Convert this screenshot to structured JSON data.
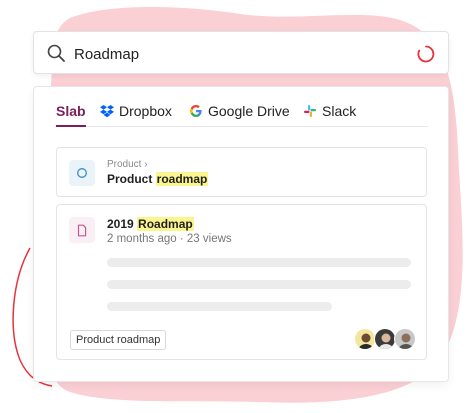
{
  "search": {
    "query": "Roadmap",
    "icon": "search-icon",
    "loading_icon": "spinner-icon"
  },
  "tabs": [
    {
      "label": "Slab",
      "icon": "",
      "active": true
    },
    {
      "label": "Dropbox",
      "icon": "dropbox-icon",
      "active": false
    },
    {
      "label": "Google Drive",
      "icon": "google-icon",
      "active": false
    },
    {
      "label": "Slack",
      "icon": "slack-icon",
      "active": false
    }
  ],
  "results": [
    {
      "breadcrumb": "Product",
      "title_prefix": "Product ",
      "title_highlight": "roadmap",
      "icon": "topic-icon"
    },
    {
      "title_prefix": "2019 ",
      "title_highlight": "Roadmap",
      "meta": "2 months ago · 23 views",
      "tag": "Product roadmap",
      "icon": "document-icon",
      "avatars": [
        "avatar-1",
        "avatar-2",
        "avatar-3"
      ]
    }
  ],
  "colors": {
    "accent": "#7a1f5c",
    "highlight": "#faf58e",
    "blob": "#fbd0d5",
    "spinner": "#e8323c"
  }
}
